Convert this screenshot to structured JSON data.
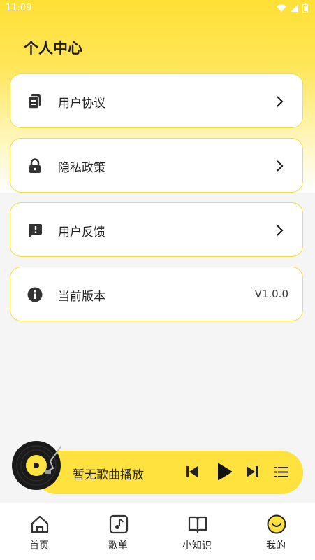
{
  "status_bar": {
    "time": "11:09"
  },
  "page": {
    "title": "个人中心"
  },
  "menu": [
    {
      "label": "用户协议",
      "icon": "document-stack-icon"
    },
    {
      "label": "隐私政策",
      "icon": "lock-icon"
    },
    {
      "label": "用户反馈",
      "icon": "feedback-icon"
    },
    {
      "label": "当前版本",
      "icon": "info-icon",
      "value": "V1.0.0"
    }
  ],
  "player": {
    "title": "暂无歌曲播放"
  },
  "tabs": [
    {
      "label": "首页",
      "icon": "home-icon"
    },
    {
      "label": "歌单",
      "icon": "music-note-icon"
    },
    {
      "label": "小知识",
      "icon": "book-icon"
    },
    {
      "label": "我的",
      "icon": "smiley-icon",
      "active": true
    }
  ],
  "colors": {
    "accent": "#ffe23d",
    "border": "#f3de3d"
  }
}
